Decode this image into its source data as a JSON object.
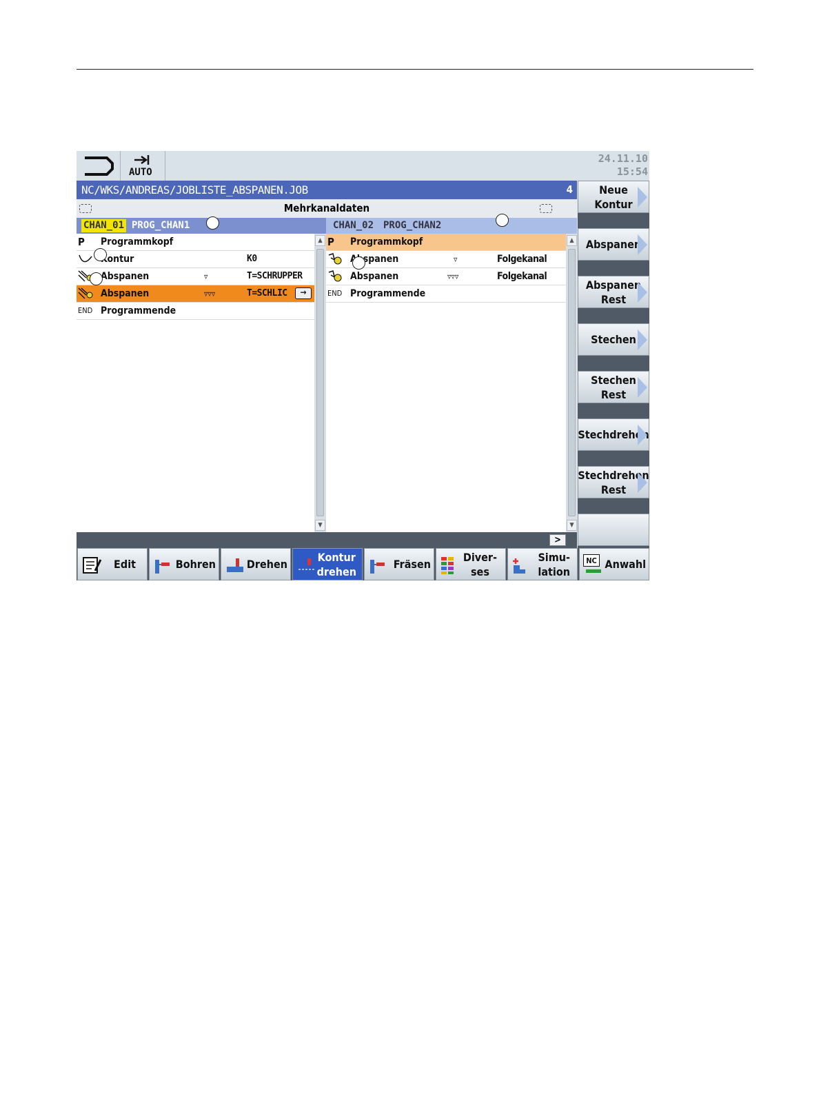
{
  "datetime": {
    "date": "24.11.10",
    "time": "15:54"
  },
  "mode": {
    "label": "AUTO"
  },
  "path": {
    "text": "NC/WKS/ANDREAS/JOBLISTE_ABSPANEN.JOB",
    "number": "4"
  },
  "multichannel": {
    "title": "Mehrkanaldaten"
  },
  "channels": {
    "left": {
      "chan": "CHAN_01",
      "prog": "PROG_CHAN1"
    },
    "right": {
      "chan": "CHAN_02",
      "prog": "PROG_CHAN2"
    }
  },
  "left_list": [
    {
      "icon": "P",
      "label": "Programmkopf",
      "c2": "",
      "c3": ""
    },
    {
      "icon": "",
      "label": "Kontur",
      "c2": "",
      "c3": "K0"
    },
    {
      "icon": "",
      "label": "Abspanen",
      "c2": "▿",
      "c3": "T=SCHRUPPER"
    },
    {
      "icon": "",
      "label": "Abspanen",
      "c2": "▿▿▿",
      "c3": "T=SCHLIC"
    },
    {
      "icon": "END",
      "label": "Programmende",
      "c2": "",
      "c3": ""
    }
  ],
  "right_list": [
    {
      "icon": "P",
      "label": "Programmkopf",
      "c2": "",
      "c3": ""
    },
    {
      "icon": "",
      "label": "Abspanen",
      "c2": "▿",
      "c3": "Folgekanal"
    },
    {
      "icon": "",
      "label": "Abspanen",
      "c2": "▿▿▿",
      "c3": "Folgekanal"
    },
    {
      "icon": "END",
      "label": "Programmende",
      "c2": "",
      "c3": ""
    }
  ],
  "vertical_softkeys": [
    {
      "label_1": "Neue",
      "label_2": "Kontur",
      "arrow": true
    },
    {
      "label_1": "Abspanen",
      "label_2": "",
      "arrow": true
    },
    {
      "label_1": "Abspanen",
      "label_2": "Rest",
      "arrow": true
    },
    {
      "label_1": "Stechen",
      "label_2": "",
      "arrow": true
    },
    {
      "label_1": "Stechen",
      "label_2": "Rest",
      "arrow": true
    },
    {
      "label_1": "Stechdrehen",
      "label_2": "",
      "arrow": true
    },
    {
      "label_1": "Stechdrehen",
      "label_2": "Rest",
      "arrow": true
    },
    {
      "label_1": "",
      "label_2": "",
      "arrow": false
    }
  ],
  "horizontal_softkeys": [
    {
      "label_1": "Edit",
      "label_2": ""
    },
    {
      "label_1": "Bohren",
      "label_2": ""
    },
    {
      "label_1": "Drehen",
      "label_2": ""
    },
    {
      "label_1": "Kontur",
      "label_2": "drehen"
    },
    {
      "label_1": "Fräsen",
      "label_2": ""
    },
    {
      "label_1": "Diver-",
      "label_2": "ses"
    },
    {
      "label_1": "Simu-",
      "label_2": "lation"
    },
    {
      "label_1": "Anwahl",
      "label_2": ""
    }
  ],
  "more_label": ">",
  "icons": {
    "nc": "NC"
  },
  "colors": {
    "path_bar": "#4c66b8",
    "selected_row": "#f08a1c",
    "highlight_row": "#f8c68c",
    "chan_active": "#f2e600",
    "softkey_active": "#2f59c3"
  }
}
